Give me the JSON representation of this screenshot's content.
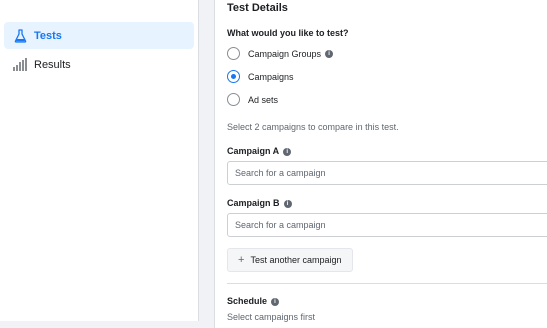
{
  "sidebar": {
    "items": [
      {
        "label": "Tests",
        "icon": "flask-icon",
        "active": true
      },
      {
        "label": "Results",
        "icon": "bar-chart-icon",
        "active": false
      }
    ]
  },
  "panel": {
    "title": "Test Details",
    "question": "What would you like to test?",
    "options": [
      {
        "label": "Campaign Groups",
        "checked": false,
        "info": true
      },
      {
        "label": "Campaigns",
        "checked": true,
        "info": false
      },
      {
        "label": "Ad sets",
        "checked": false,
        "info": false
      }
    ],
    "hint": "Select 2 campaigns to compare in this test.",
    "campaign_a": {
      "label": "Campaign A",
      "placeholder": "Search for a campaign"
    },
    "campaign_b": {
      "label": "Campaign B",
      "placeholder": "Search for a campaign"
    },
    "add_button": "Test another campaign",
    "schedule": {
      "label": "Schedule",
      "hint": "Select campaigns first"
    }
  },
  "colors": {
    "accent": "#1877f2",
    "active_bg": "#e7f3ff"
  }
}
